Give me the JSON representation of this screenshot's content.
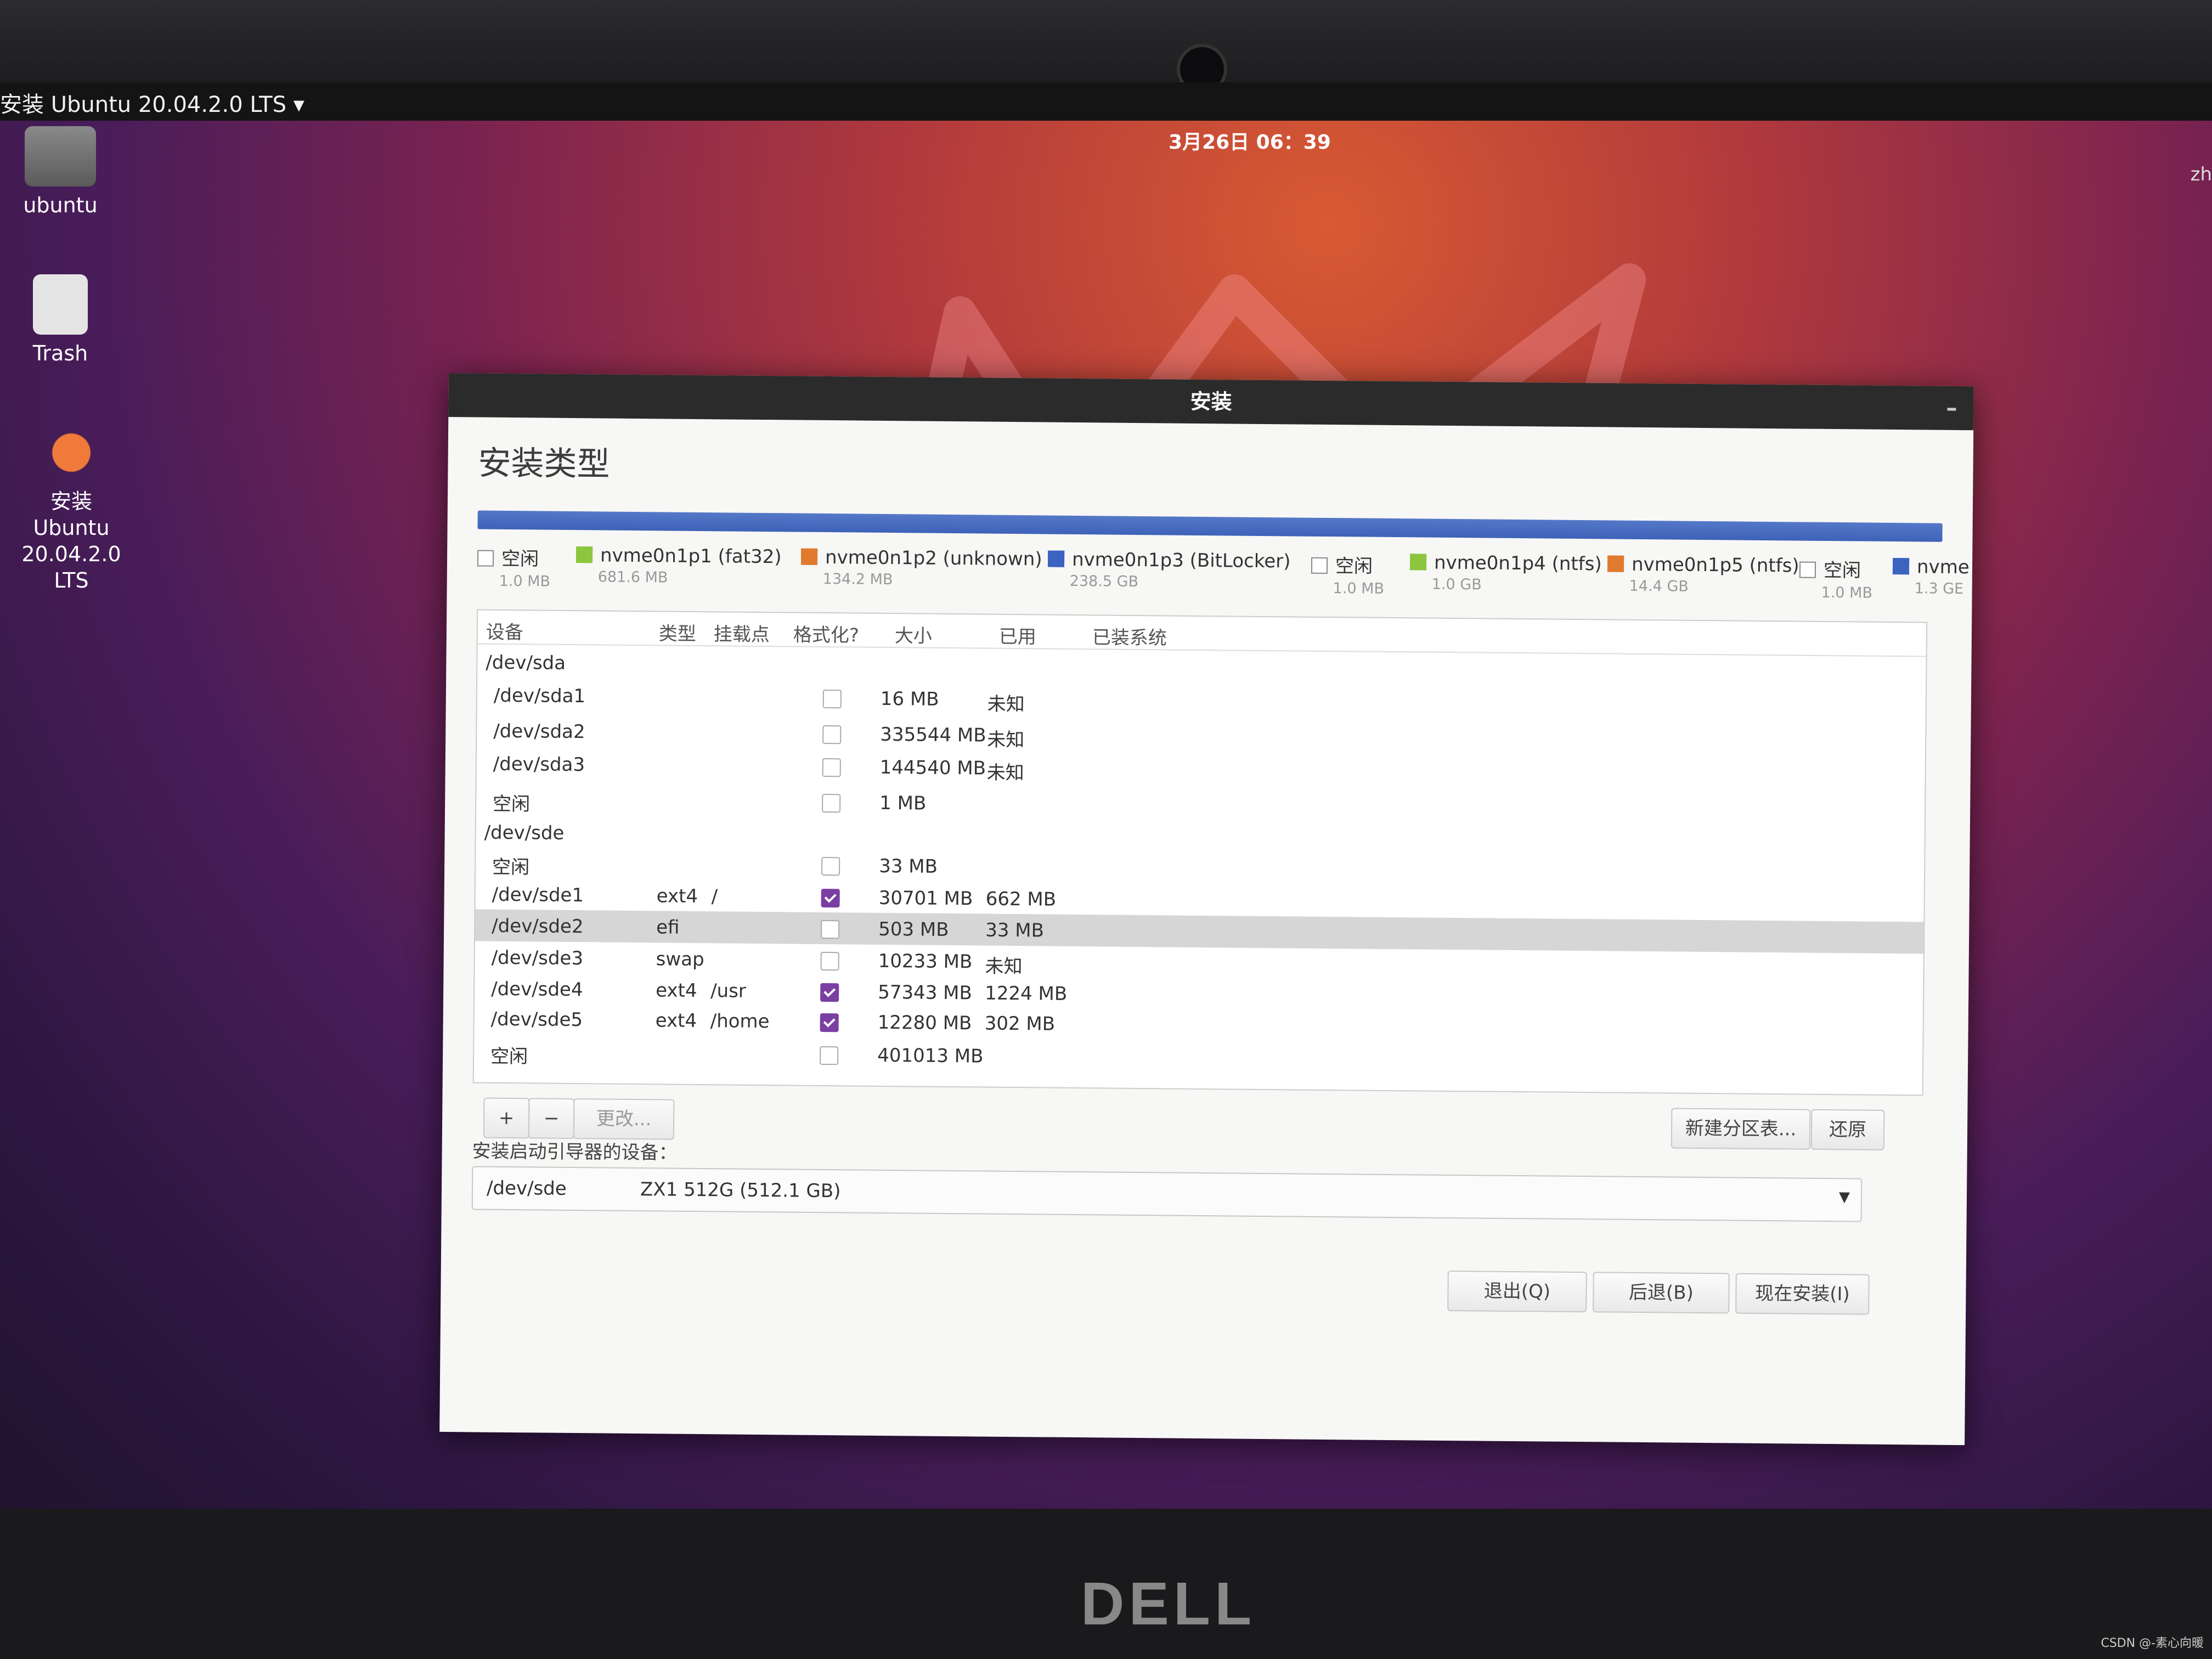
{
  "topbar": {
    "app_menu": "安装 Ubuntu 20.04.2.0 LTS ▾",
    "clock": "3月26日  06：39",
    "user_corner": "zh"
  },
  "desktop": {
    "home_label": "ubuntu",
    "trash_label": "Trash",
    "installer_label_1": "安装 Ubuntu",
    "installer_label_2": "20.04.2.0 LTS"
  },
  "dialog": {
    "title": "安装",
    "page_title": "安装类型",
    "legend": [
      {
        "name": "空闲",
        "size": "1.0 MB",
        "color": "#ffffff"
      },
      {
        "name": "nvme0n1p1 (fat32)",
        "size": "681.6 MB",
        "color": "#8cc63e"
      },
      {
        "name": "nvme0n1p2 (unknown)",
        "size": "134.2 MB",
        "color": "#e07a2e"
      },
      {
        "name": "nvme0n1p3 (BitLocker)",
        "size": "238.5 GB",
        "color": "#3b64c0"
      },
      {
        "name": "空闲",
        "size": "1.0 MB",
        "color": "#ffffff"
      },
      {
        "name": "nvme0n1p4 (ntfs)",
        "size": "1.0 GB",
        "color": "#8cc63e"
      },
      {
        "name": "nvme0n1p5 (ntfs)",
        "size": "14.4 GB",
        "color": "#e07a2e"
      },
      {
        "name": "空闲",
        "size": "1.0 MB",
        "color": "#ffffff"
      },
      {
        "name": "nvme",
        "size": "1.3 GE",
        "color": "#3b64c0"
      }
    ],
    "columns": [
      "设备",
      "类型",
      "挂载点",
      "格式化?",
      "大小",
      "已用",
      "已装系统"
    ],
    "rows": [
      {
        "device": "/dev/sda",
        "type": "",
        "mount": "",
        "format": null,
        "size": "",
        "used": ""
      },
      {
        "device": "/dev/sda1",
        "type": "",
        "mount": "",
        "format": false,
        "size": "16 MB",
        "used": "未知"
      },
      {
        "device": "/dev/sda2",
        "type": "",
        "mount": "",
        "format": false,
        "size": "335544 MB",
        "used": "未知"
      },
      {
        "device": "/dev/sda3",
        "type": "",
        "mount": "",
        "format": false,
        "size": "144540 MB",
        "used": "未知"
      },
      {
        "device": "空闲",
        "type": "",
        "mount": "",
        "format": false,
        "size": "1 MB",
        "used": ""
      },
      {
        "device": "/dev/sde",
        "type": "",
        "mount": "",
        "format": null,
        "size": "",
        "used": ""
      },
      {
        "device": "空闲",
        "type": "",
        "mount": "",
        "format": false,
        "size": "33 MB",
        "used": ""
      },
      {
        "device": "/dev/sde1",
        "type": "ext4",
        "mount": "/",
        "format": true,
        "size": "30701 MB",
        "used": "662 MB"
      },
      {
        "device": "/dev/sde2",
        "type": "efi",
        "mount": "",
        "format": false,
        "size": "503 MB",
        "used": "33 MB",
        "selected": true
      },
      {
        "device": "/dev/sde3",
        "type": "swap",
        "mount": "",
        "format": false,
        "size": "10233 MB",
        "used": "未知"
      },
      {
        "device": "/dev/sde4",
        "type": "ext4",
        "mount": "/usr",
        "format": true,
        "size": "57343 MB",
        "used": "1224 MB"
      },
      {
        "device": "/dev/sde5",
        "type": "ext4",
        "mount": "/home",
        "format": true,
        "size": "12280 MB",
        "used": "302 MB"
      },
      {
        "device": "空闲",
        "type": "",
        "mount": "",
        "format": false,
        "size": "401013 MB",
        "used": ""
      }
    ],
    "toolbar": {
      "add": "+",
      "remove": "−",
      "change": "更改...",
      "new_table": "新建分区表...",
      "revert": "还原"
    },
    "bootloader_label": "安装启动引导器的设备：",
    "bootloader_device": "/dev/sde",
    "bootloader_desc": "ZX1 512G (512.1 GB)",
    "buttons": {
      "quit": "退出(Q)",
      "back": "后退(B)",
      "install": "现在安装(I)"
    }
  },
  "laptop_brand": "DELL",
  "watermark": "CSDN @-素心向暖"
}
